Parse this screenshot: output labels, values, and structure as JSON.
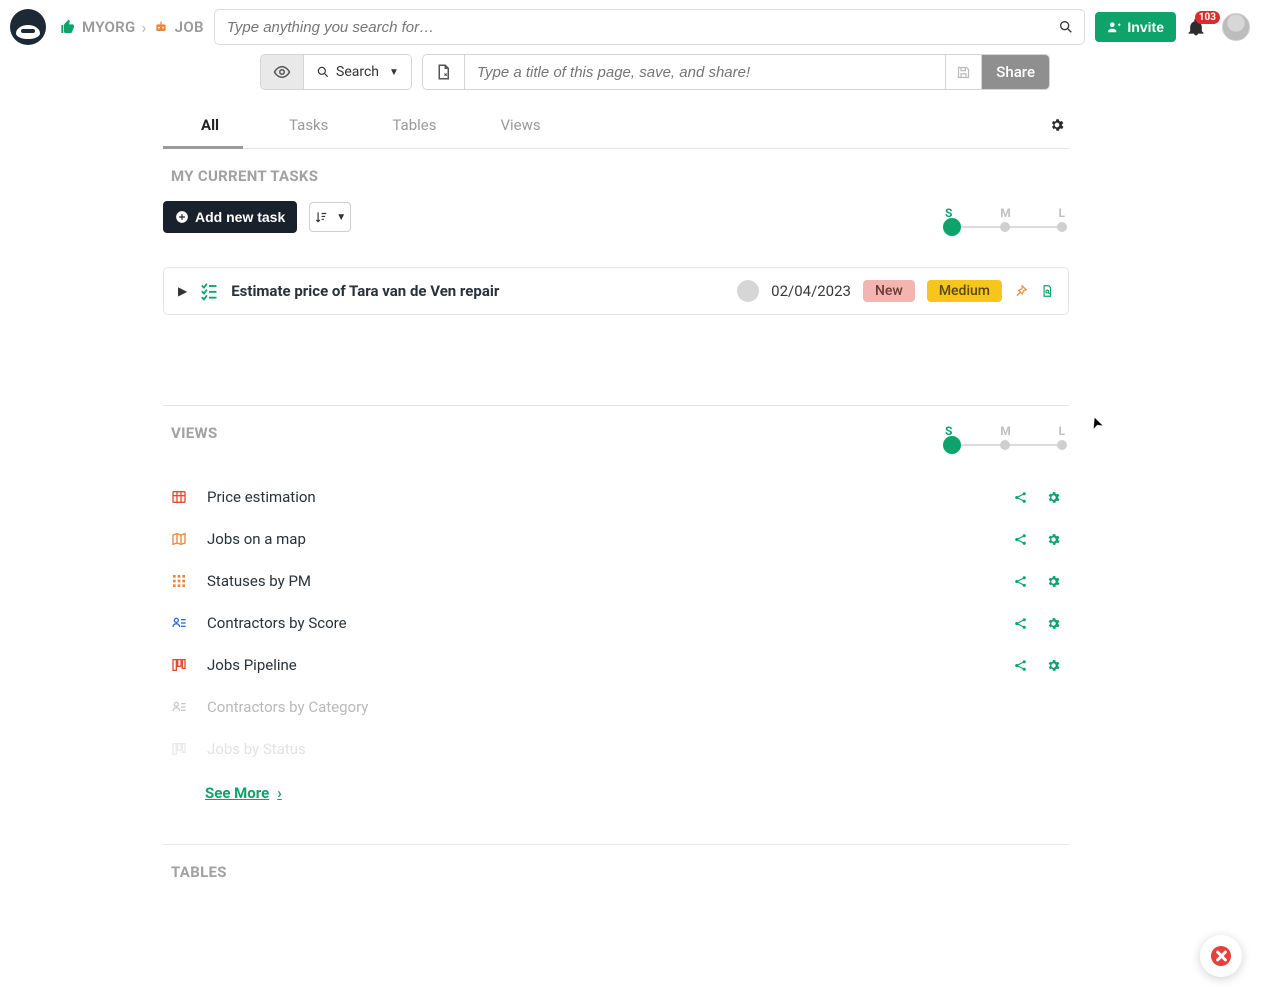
{
  "header": {
    "breadcrumb": {
      "org": "MYORG",
      "page": "JOB"
    },
    "search_placeholder": "Type anything you search for…",
    "invite_label": "Invite",
    "notification_count": "103"
  },
  "toolbar": {
    "search_label": "Search",
    "title_placeholder": "Type a title of this page, save, and share!",
    "share_label": "Share"
  },
  "tabs": {
    "items": [
      "All",
      "Tasks",
      "Tables",
      "Views"
    ],
    "active_index": 0
  },
  "current_tasks": {
    "title": "MY CURRENT TASKS",
    "add_label": "Add new task",
    "size_labels": [
      "S",
      "M",
      "L"
    ],
    "items": [
      {
        "title": "Estimate price of Tara van de Ven repair",
        "date": "02/04/2023",
        "status": "New",
        "priority": "Medium"
      }
    ]
  },
  "views": {
    "title": "VIEWS",
    "size_labels": [
      "S",
      "M",
      "L"
    ],
    "items": [
      {
        "label": "Price estimation",
        "icon": "table",
        "tone": "ic-red"
      },
      {
        "label": "Jobs on a map",
        "icon": "map",
        "tone": "ic-orange"
      },
      {
        "label": "Statuses by PM",
        "icon": "matrix",
        "tone": "ic-orange"
      },
      {
        "label": "Contractors by Score",
        "icon": "roster",
        "tone": "ic-blue"
      },
      {
        "label": "Jobs Pipeline",
        "icon": "kanban",
        "tone": "ic-red"
      },
      {
        "label": "Contractors by Category",
        "icon": "roster",
        "tone": "",
        "muted": 1
      },
      {
        "label": "Jobs by Status",
        "icon": "kanban",
        "tone": "",
        "muted": 2
      }
    ],
    "see_more": "See More"
  },
  "tables": {
    "title": "TABLES"
  }
}
